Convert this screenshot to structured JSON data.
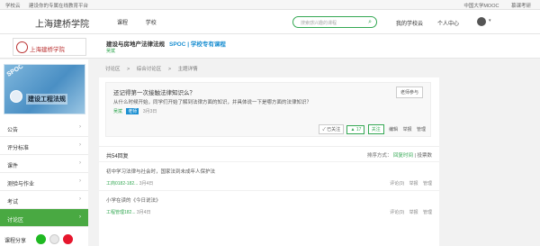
{
  "topstrip": {
    "site": "学校云",
    "tagline": "建设你的专属在线教育平台",
    "mooc": "中国大学MOOC",
    "user": "慕课考研"
  },
  "header": {
    "brand": "上海建桥学院",
    "nav": [
      "课程",
      "学校"
    ],
    "search_placeholder": "搜索感兴趣的课程",
    "my_school_cloud": "我的学校云",
    "personal_center": "个人中心"
  },
  "course": {
    "logo_text": "上海建桥学院",
    "title": "建设与房地产法律法规",
    "tag": "SPOC | 学校专有课程",
    "teacher": "吴斌",
    "thumb_title": "建设工程法规",
    "thumb_badge": "SPOC"
  },
  "sidebar": {
    "items": [
      {
        "label": "公告",
        "active": false
      },
      {
        "label": "评分标准",
        "active": false
      },
      {
        "label": "课件",
        "active": false
      },
      {
        "label": "测验与作业",
        "active": false
      },
      {
        "label": "考试",
        "active": false
      },
      {
        "label": "讨论区",
        "active": true
      }
    ],
    "share_label": "课程分享"
  },
  "breadcrumb": [
    "讨论区",
    ">",
    "综合讨论区",
    ">",
    "主题详情"
  ],
  "post": {
    "question": "还记得第一次接触法律知识么？",
    "badge": "老师参与",
    "body": "从什么时候开始，同学们开始了解到法律方面的知识，并具体说一下是哪方面的法律知识？",
    "author": "吴斌",
    "role": "老师",
    "date": "3月3日",
    "vote_label": "已关注",
    "vote_count": "17",
    "follow_label": "关注",
    "ops": [
      "编辑",
      "举报",
      "管理"
    ]
  },
  "replies_header": {
    "count": "共54回复",
    "sort_label": "排序方式：",
    "sort_active": "回复时间",
    "vote_label": "投票数"
  },
  "replies": [
    {
      "text": "初中学习法律与社会时，国家法到未成年人保护法",
      "author": "工商0182-182...",
      "date": "3月4日",
      "ops": [
        "评论(0)",
        "举报",
        "管理"
      ]
    },
    {
      "text": "小学在读的《今日说法》",
      "author": "工程管理182...",
      "date": "3月4日",
      "ops": [
        "评论(0)",
        "举报",
        "管理"
      ]
    }
  ],
  "icons": {
    "search": "search-icon",
    "caret": "chevron-down-icon"
  },
  "colors": {
    "accent_green": "#34a853",
    "link_blue": "#1b8fd1",
    "active_green": "#49a942"
  }
}
